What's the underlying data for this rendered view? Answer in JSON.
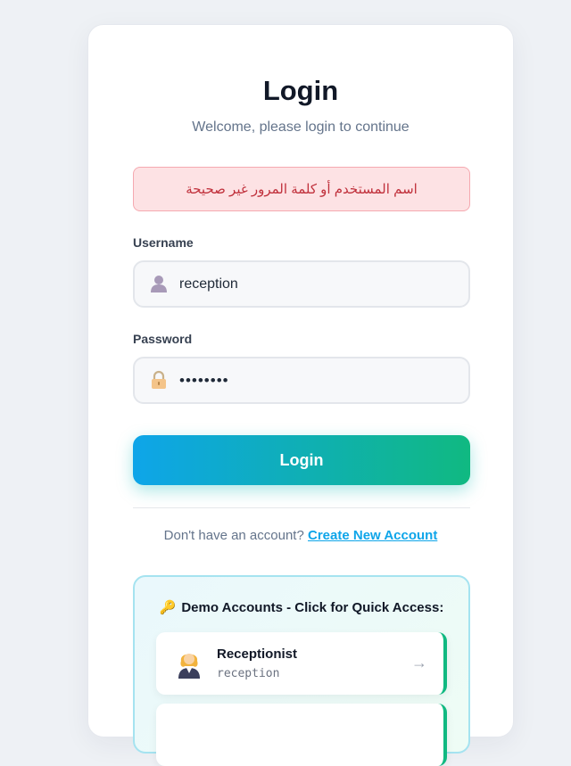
{
  "login": {
    "title": "Login",
    "subtitle": "Welcome, please login to continue",
    "error_message": "اسم المستخدم أو كلمة المرور غير صحيحة",
    "username_label": "Username",
    "username_value": "reception",
    "password_label": "Password",
    "password_value": "••••••••",
    "submit_label": "Login"
  },
  "signup": {
    "prompt": "Don't have an account?",
    "link_label": "Create New Account"
  },
  "demo": {
    "icon": "🔑",
    "title": "Demo Accounts - Click for Quick Access:",
    "accounts": [
      {
        "name": "Receptionist",
        "username": "reception",
        "icon": "receptionist-avatar-icon"
      }
    ],
    "arrow": "→"
  },
  "colors": {
    "accent_start": "#0ea5e9",
    "accent_end": "#10b981",
    "error_bg": "#fde2e4",
    "error_text": "#c0303b"
  }
}
